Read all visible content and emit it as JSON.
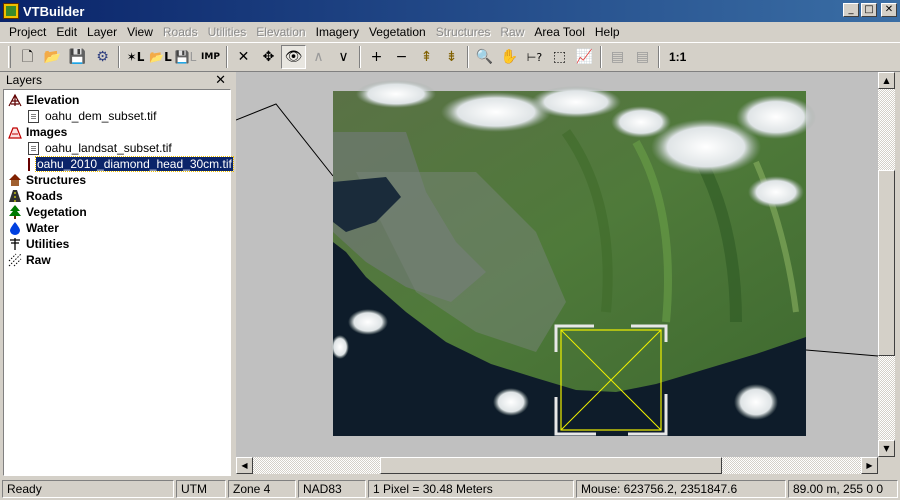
{
  "window": {
    "title": "VTBuilder",
    "icon": "vtbuilder-app-icon",
    "minimize_label": "_",
    "maximize_label": "□",
    "close_label": "✕"
  },
  "menu": [
    {
      "label": "Project",
      "enabled": true
    },
    {
      "label": "Edit",
      "enabled": true
    },
    {
      "label": "Layer",
      "enabled": true
    },
    {
      "label": "View",
      "enabled": true
    },
    {
      "label": "Roads",
      "enabled": false
    },
    {
      "label": "Utilities",
      "enabled": false
    },
    {
      "label": "Elevation",
      "enabled": false
    },
    {
      "label": "Imagery",
      "enabled": true
    },
    {
      "label": "Vegetation",
      "enabled": true
    },
    {
      "label": "Structures",
      "enabled": false
    },
    {
      "label": "Raw",
      "enabled": false
    },
    {
      "label": "Area Tool",
      "enabled": true
    },
    {
      "label": "Help",
      "enabled": true
    }
  ],
  "toolbar": {
    "ratio_label": "1:1",
    "icons": [
      "new-file-icon",
      "open-folder-icon",
      "save-icon",
      "settings-icon",
      "new-layer-icon",
      "open-layer-icon",
      "save-layer-icon",
      "import-icon",
      "delete-icon",
      "move-icon",
      "visibility-eye-icon",
      "raise-icon",
      "lower-icon",
      "zoom-in-icon",
      "zoom-out-icon",
      "layer-up-icon",
      "layer-down-icon",
      "magnifier-icon",
      "pan-hand-icon",
      "distance-icon",
      "area-select-icon",
      "profile-icon",
      "disabled-tool-1-icon",
      "disabled-tool-2-icon"
    ]
  },
  "layers_panel": {
    "title": "Layers",
    "close_label": "✕",
    "tree": [
      {
        "type": "category",
        "label": "Elevation",
        "icon": "elevation-icon"
      },
      {
        "type": "file",
        "label": "oahu_dem_subset.tif",
        "icon": "file-icon"
      },
      {
        "type": "category",
        "label": "Images",
        "icon": "images-icon"
      },
      {
        "type": "file",
        "label": "oahu_landsat_subset.tif",
        "icon": "file-icon"
      },
      {
        "type": "file",
        "label": "oahu_2010_diamond_head_30cm.tif",
        "icon": "active-image-icon",
        "selected": true
      },
      {
        "type": "category",
        "label": "Structures",
        "icon": "structures-house-icon"
      },
      {
        "type": "category",
        "label": "Roads",
        "icon": "roads-icon"
      },
      {
        "type": "category",
        "label": "Vegetation",
        "icon": "vegetation-tree-icon"
      },
      {
        "type": "category",
        "label": "Water",
        "icon": "water-drop-icon"
      },
      {
        "type": "category",
        "label": "Utilities",
        "icon": "utilities-pole-icon"
      },
      {
        "type": "category",
        "label": "Raw",
        "icon": "raw-points-icon"
      }
    ]
  },
  "status": {
    "ready": "Ready",
    "projection": "UTM",
    "zone": "Zone 4",
    "datum": "NAD83",
    "pixel_size": "1 Pixel = 30.48 Meters",
    "mouse": "Mouse: 623756.2, 2351847.6",
    "elevation": "89.00 m, 255 0 0"
  },
  "colors": {
    "title_gradient_start": "#0a246a",
    "selection": "#0a246a",
    "extent_box": "#f0f000",
    "chrome": "#d4d0c8"
  }
}
